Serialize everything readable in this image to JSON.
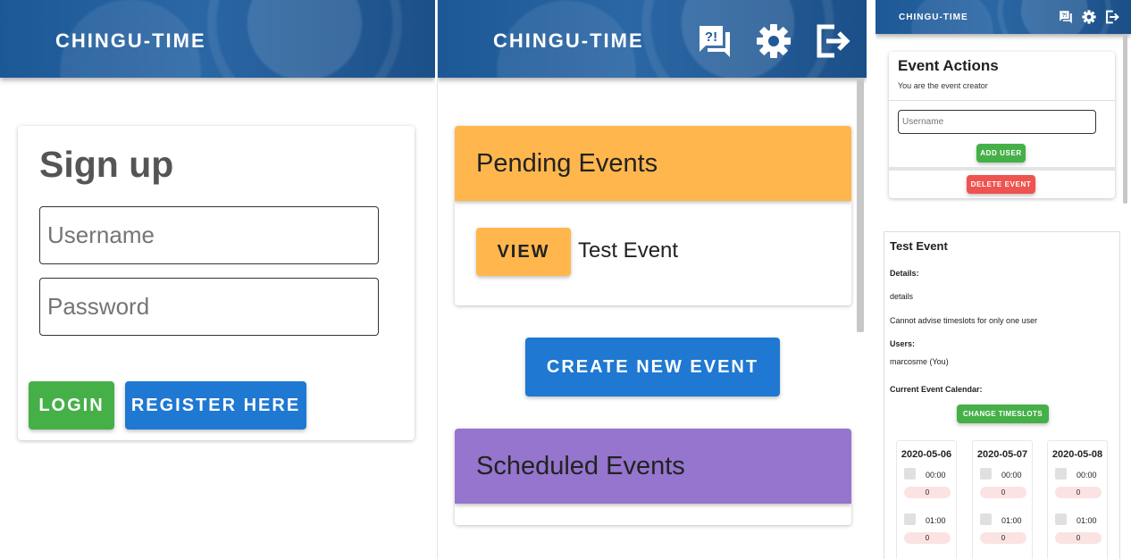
{
  "app": {
    "title": "CHINGU-TIME"
  },
  "signup": {
    "title": "Sign up",
    "username_placeholder": "Username",
    "password_placeholder": "Password",
    "login_label": "LOGIN",
    "register_label": "REGISTER HERE"
  },
  "dashboard": {
    "pending": {
      "title": "Pending Events",
      "view_label": "VIEW",
      "event_name": "Test Event"
    },
    "create_label": "CREATE NEW EVENT",
    "scheduled": {
      "title": "Scheduled Events"
    },
    "icons": [
      "question-answer-icon",
      "gear-icon",
      "logout-icon"
    ]
  },
  "event_actions": {
    "title": "Event Actions",
    "subtitle": "You are the event creator",
    "username_placeholder": "Username",
    "add_user_label": "ADD USER",
    "delete_label": "DELETE EVENT"
  },
  "event_details": {
    "title": "Test Event",
    "details_label": "Details:",
    "details": "details",
    "advise_note": "Cannot advise timeslots for only one user",
    "users_label": "Users:",
    "users": "marcosme (You)",
    "calendar_label": "Current Event Calendar:",
    "change_label": "CHANGE TIMESLOTS",
    "days": [
      {
        "date": "2020-05-06",
        "slots": [
          {
            "time": "00:00",
            "count": "0"
          },
          {
            "time": "01:00",
            "count": "0"
          }
        ]
      },
      {
        "date": "2020-05-07",
        "slots": [
          {
            "time": "00:00",
            "count": "0"
          },
          {
            "time": "01:00",
            "count": "0"
          }
        ]
      },
      {
        "date": "2020-05-08",
        "slots": [
          {
            "time": "00:00",
            "count": "0"
          },
          {
            "time": "01:00",
            "count": "0"
          }
        ]
      }
    ]
  },
  "colors": {
    "appbar": "#1f5a96",
    "green": "#45b048",
    "blue": "#1f78d1",
    "orange": "#ffb74d",
    "purple": "#9575cd",
    "red": "#ef5350"
  }
}
